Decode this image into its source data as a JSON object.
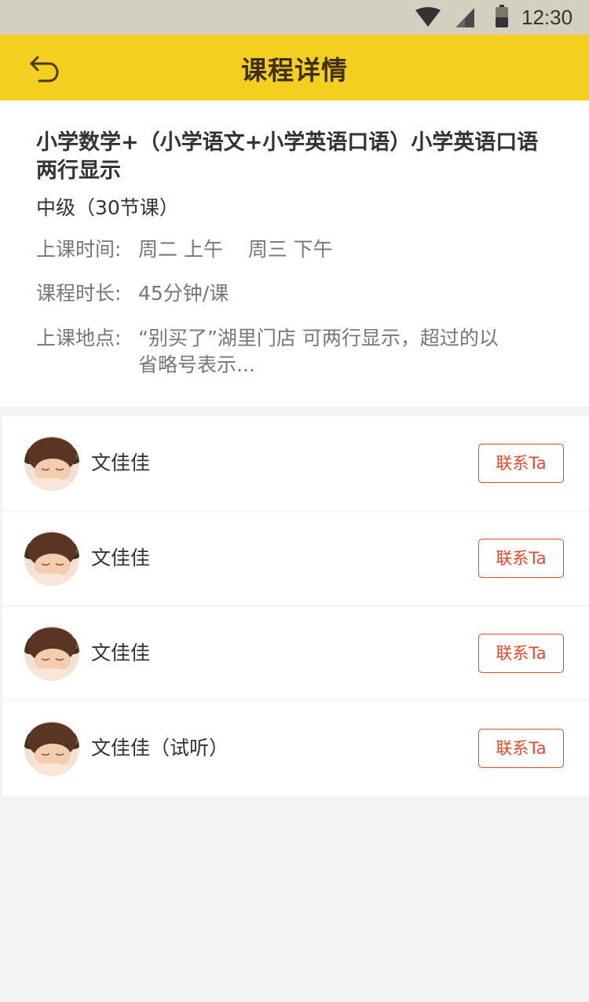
{
  "status_bar": {
    "time": "12:30",
    "icons": [
      "wifi-icon",
      "cell-signal-icon",
      "battery-icon"
    ]
  },
  "header": {
    "title": "课程详情",
    "back_icon": "back-arrow-icon"
  },
  "course": {
    "title": "小学数学+（小学语文+小学英语口语）小学英语口语两行显示",
    "level": "中级（30节课）",
    "time_label": "上课时间:",
    "time_value": "周二 上午    周三 下午",
    "duration_label": "课程时长:",
    "duration_value": "45分钟/课",
    "location_label": "上课地点:",
    "location_value": "“别买了”湖里门店 可两行显示，超过的以省略号表示..."
  },
  "teachers": [
    {
      "name": "文佳佳",
      "contact_label": "联系Ta"
    },
    {
      "name": "文佳佳",
      "contact_label": "联系Ta"
    },
    {
      "name": "文佳佳",
      "contact_label": "联系Ta"
    },
    {
      "name": "文佳佳（试听）",
      "contact_label": "联系Ta"
    }
  ],
  "colors": {
    "header_bg": "#f3cf20",
    "accent": "#e04a2b",
    "page_bg": "#f3f3f3"
  }
}
